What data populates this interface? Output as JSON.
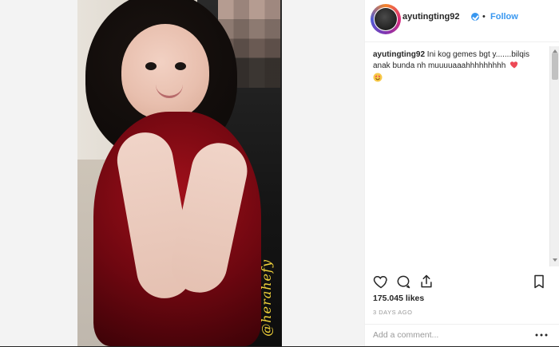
{
  "post": {
    "username": "ayutingting92",
    "follow_label": "Follow",
    "separator": "•",
    "caption_user": "ayutingting92",
    "caption_text": "Ini kog gemes bgt y.......bilqis anak bunda nh muuuuaaahhhhhhhhh",
    "likes": "175.045 likes",
    "date": "3 DAYS AGO",
    "comment_placeholder": "Add a comment...",
    "image_watermark": "@herahefy"
  },
  "colors": {
    "primary_text": "#262626",
    "link_blue": "#3897f0",
    "muted": "#999999",
    "heart_red": "#ed4956",
    "emoji_yellow": "#f7c948"
  },
  "icons": {
    "like": "heart-outline-icon",
    "comment": "comment-bubble-icon",
    "share": "share-icon",
    "save": "bookmark-icon",
    "more": "more-options-icon",
    "verified": "verified-badge-icon"
  }
}
